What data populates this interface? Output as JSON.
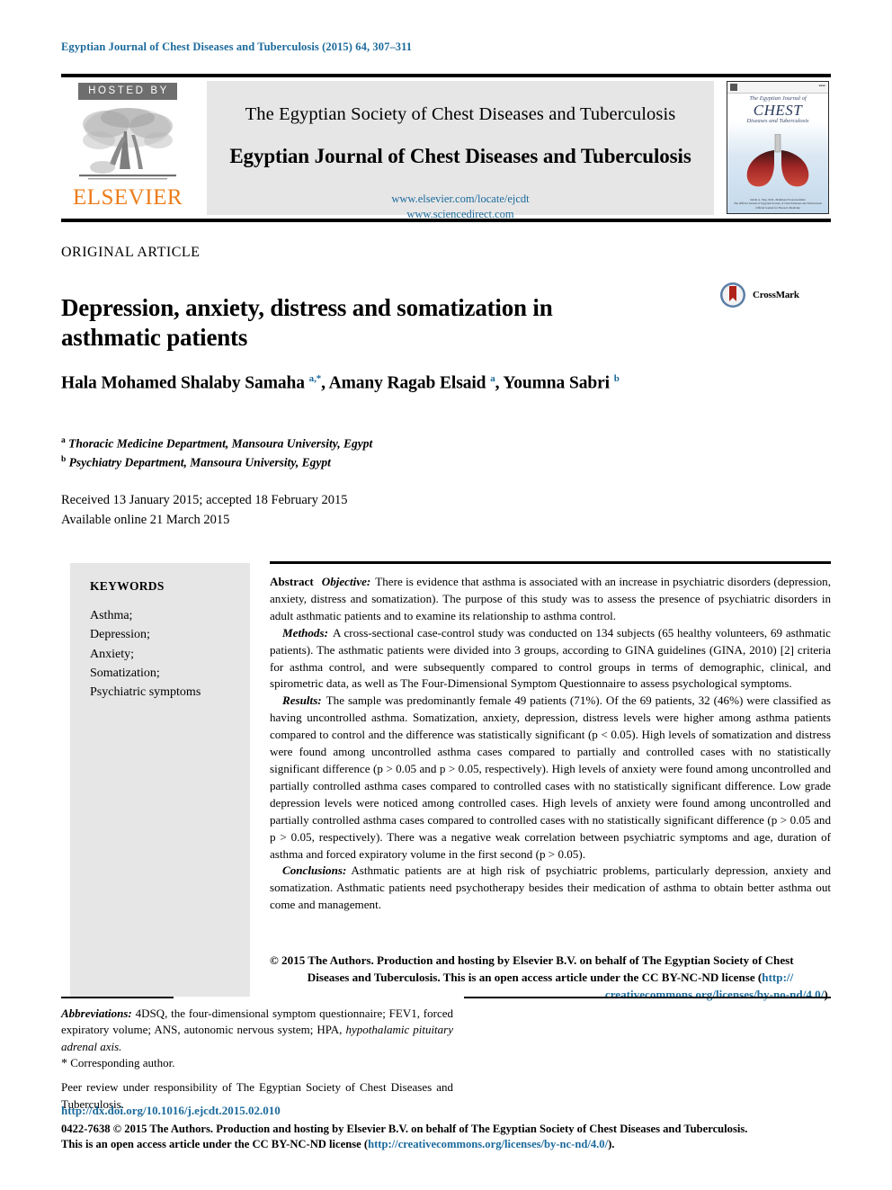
{
  "running_head": "Egyptian Journal of Chest Diseases and Tuberculosis (2015) 64, 307–311",
  "masthead": {
    "hosted_by": "HOSTED BY",
    "publisher": "ELSEVIER",
    "society": "The Egyptian Society of Chest Diseases and Tuberculosis",
    "journal": "Egyptian Journal of Chest Diseases and Tuberculosis",
    "url_locate": "www.elsevier.com/locate/ejcdt",
    "url_sciencedirect": "www.sciencedirect.com",
    "cover": {
      "line1": "The Egyptian Journal of",
      "line2": "CHEST",
      "line3": "Diseases and Tuberculosis",
      "footer1": "Ismail A. Sing, M.D., Mahmoud Fouad Asfahan",
      "footer2": "The Official Journal of Egyptian Society of Chest Diseases and Tuberculosis",
      "footer3": "Official Journal for Thoracic Medicine"
    }
  },
  "article": {
    "type": "ORIGINAL ARTICLE",
    "title": "Depression, anxiety, distress and somatization in asthmatic patients",
    "crossmark_label": "CrossMark",
    "authors_html": "Hala Mohamed Shalaby Samaha <sup>a,*</sup>, Amany Ragab Elsaid <sup>a</sup>, Youmna Sabri <sup>b</sup>",
    "affiliations": [
      {
        "marker": "a",
        "text": "Thoracic Medicine Department, Mansoura University, Egypt"
      },
      {
        "marker": "b",
        "text": "Psychiatry Department, Mansoura University, Egypt"
      }
    ],
    "received": "Received 13 January 2015; accepted 18 February 2015",
    "available_online": "Available online 21 March 2015"
  },
  "keywords": {
    "heading": "KEYWORDS",
    "items": [
      "Asthma;",
      "Depression;",
      "Anxiety;",
      "Somatization;",
      "Psychiatric symptoms"
    ]
  },
  "abstract": {
    "label": "Abstract",
    "objective_label": "Objective:",
    "objective_text": "There is evidence that asthma is associated with an increase in psychiatric disorders (depression, anxiety, distress and somatization). The purpose of this study was to assess the presence of psychiatric disorders in adult asthmatic patients and to examine its relationship to asthma control.",
    "methods_label": "Methods:",
    "methods_text": "A cross-sectional case-control study was conducted on 134 subjects (65 healthy volunteers, 69 asthmatic patients). The asthmatic patients were divided into 3 groups, according to GINA guidelines (GINA, 2010) [2] criteria for asthma control, and were subsequently compared to control groups in terms of demographic, clinical, and spirometric data, as well as The Four-Dimensional Symptom Questionnaire to assess psychological symptoms.",
    "results_label": "Results:",
    "results_text": "The sample was predominantly female 49 patients (71%). Of the 69 patients, 32 (46%) were classified as having uncontrolled asthma. Somatization, anxiety, depression, distress levels were higher among asthma patients compared to control and the difference was statistically significant (p < 0.05). High levels of somatization and distress were found among uncontrolled asthma cases compared to partially and controlled cases with no statistically significant difference (p > 0.05 and p > 0.05, respectively). High levels of anxiety were found among uncontrolled and partially controlled asthma cases compared to controlled cases with no statistically significant difference. Low grade depression levels were noticed among controlled cases. High levels of anxiety were found among uncontrolled and partially controlled asthma cases compared to controlled cases with no statistically significant difference (p > 0.05 and p > 0.05, respectively). There was a negative weak correlation between psychiatric symptoms and age, duration of asthma and forced expiratory volume in the first second (p > 0.05).",
    "conclusions_label": "Conclusions:",
    "conclusions_text": "Asthmatic patients are at high risk of psychiatric problems, particularly depression, anxiety and somatization. Asthmatic patients need psychotherapy besides their medication of asthma to obtain better asthma out come and management.",
    "copyright_line1": "© 2015 The Authors. Production and hosting by Elsevier B.V. on behalf of The Egyptian Society of Chest",
    "copyright_line2": "Diseases and Tuberculosis.  This is an open access article under the CC BY-NC-ND license (",
    "copyright_link1": "http://",
    "copyright_link2": "creativecommons.org/licenses/by-no-nd/4.0/",
    "copyright_tail": ")."
  },
  "footnotes": {
    "abbreviations_label": "Abbreviations:",
    "abbreviations_text": "4DSQ, the four-dimensional symptom questionnaire; FEV1, forced expiratory volume; ANS, autonomic nervous system; HPA, ",
    "abbreviations_italic_tail": "hypothalamic pituitary adrenal axis.",
    "corresponding": "Corresponding author.",
    "peer_review": "Peer review under responsibility of The Egyptian Society of Chest Diseases and Tuberculosis."
  },
  "footer": {
    "doi": "http://dx.doi.org/10.1016/j.ejcdt.2015.02.010",
    "license_line1": "0422-7638 © 2015 The Authors. Production and hosting by Elsevier B.V. on behalf of The Egyptian Society of Chest Diseases and Tuberculosis.",
    "license_line2_pre": "This is an open access article under the CC BY-NC-ND license (",
    "license_link": "http://creativecommons.org/licenses/by-nc-nd/4.0/",
    "license_line2_post": ")."
  },
  "colors": {
    "link": "#1b6a9c",
    "elsevier_orange": "#ee7c1a",
    "panel_gray": "#e6e6e6",
    "hosted_gray": "#6e6e6e"
  }
}
